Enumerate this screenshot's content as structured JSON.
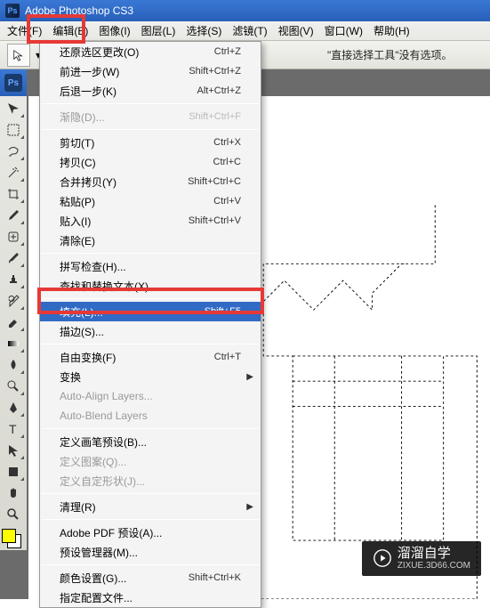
{
  "titlebar": {
    "title": "Adobe Photoshop CS3"
  },
  "menubar": {
    "items": [
      {
        "label": "文件(F)"
      },
      {
        "label": "编辑(E)"
      },
      {
        "label": "图像(I)"
      },
      {
        "label": "图层(L)"
      },
      {
        "label": "选择(S)"
      },
      {
        "label": "滤镜(T)"
      },
      {
        "label": "视图(V)"
      },
      {
        "label": "窗口(W)"
      },
      {
        "label": "帮助(H)"
      }
    ]
  },
  "optionsbar": {
    "message": "\"直接选择工具\"没有选项。"
  },
  "dropdown": {
    "items": [
      {
        "label": "还原选区更改(O)",
        "shortcut": "Ctrl+Z"
      },
      {
        "label": "前进一步(W)",
        "shortcut": "Shift+Ctrl+Z"
      },
      {
        "label": "后退一步(K)",
        "shortcut": "Alt+Ctrl+Z"
      },
      {
        "sep": true
      },
      {
        "label": "渐隐(D)...",
        "shortcut": "Shift+Ctrl+F",
        "disabled": true
      },
      {
        "sep": true
      },
      {
        "label": "剪切(T)",
        "shortcut": "Ctrl+X"
      },
      {
        "label": "拷贝(C)",
        "shortcut": "Ctrl+C"
      },
      {
        "label": "合并拷贝(Y)",
        "shortcut": "Shift+Ctrl+C"
      },
      {
        "label": "粘贴(P)",
        "shortcut": "Ctrl+V"
      },
      {
        "label": "贴入(I)",
        "shortcut": "Shift+Ctrl+V"
      },
      {
        "label": "清除(E)"
      },
      {
        "sep": true
      },
      {
        "label": "拼写检查(H)..."
      },
      {
        "label": "查找和替换文本(X)..."
      },
      {
        "sep": true
      },
      {
        "label": "填充(L)...",
        "shortcut": "Shift+F5",
        "highlight": true
      },
      {
        "label": "描边(S)..."
      },
      {
        "sep": true
      },
      {
        "label": "自由变换(F)",
        "shortcut": "Ctrl+T"
      },
      {
        "label": "变换",
        "submenu": true
      },
      {
        "label": "Auto-Align Layers...",
        "disabled": true
      },
      {
        "label": "Auto-Blend Layers",
        "disabled": true
      },
      {
        "sep": true
      },
      {
        "label": "定义画笔预设(B)..."
      },
      {
        "label": "定义图案(Q)...",
        "disabled": true
      },
      {
        "label": "定义自定形状(J)...",
        "disabled": true
      },
      {
        "sep": true
      },
      {
        "label": "清理(R)",
        "submenu": true
      },
      {
        "sep": true
      },
      {
        "label": "Adobe PDF 预设(A)..."
      },
      {
        "label": "预设管理器(M)..."
      },
      {
        "sep": true
      },
      {
        "label": "颜色设置(G)...",
        "shortcut": "Shift+Ctrl+K"
      },
      {
        "label": "指定配置文件..."
      }
    ]
  },
  "toolbox": {
    "tools": [
      "move-tool",
      "marquee-tool",
      "lasso-tool",
      "magic-wand-tool",
      "crop-tool",
      "eyedropper-tool",
      "healing-brush-tool",
      "brush-tool",
      "clone-stamp-tool",
      "history-brush-tool",
      "eraser-tool",
      "gradient-tool",
      "blur-tool",
      "dodge-tool",
      "pen-tool",
      "type-tool",
      "path-selection-tool",
      "shape-tool",
      "hand-tool",
      "zoom-tool"
    ]
  },
  "watermark": {
    "brand": "溜溜自学",
    "url": "ZIXUE.3D66.COM"
  }
}
